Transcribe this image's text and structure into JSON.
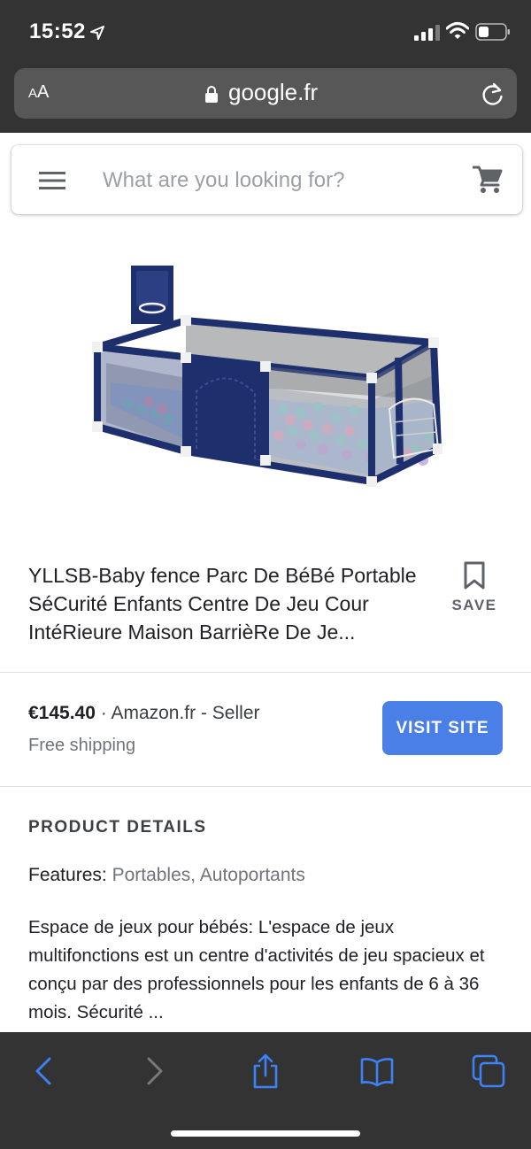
{
  "status_bar": {
    "time": "15:52",
    "icons": [
      "location-arrow-icon",
      "cellular-signal-icon",
      "wifi-icon",
      "battery-icon"
    ]
  },
  "browser": {
    "text_size_label_small": "A",
    "text_size_label_large": "A",
    "url": "google.fr",
    "icons": [
      "lock-icon",
      "reload-icon"
    ]
  },
  "search": {
    "placeholder": "What are you looking for?",
    "icons": [
      "menu-icon",
      "cart-icon"
    ]
  },
  "product": {
    "image_alt": "Blue baby playpen with colored balls and basketball hoop",
    "title": "YLLSB-Baby fence Parc De BéBé Portable SéCurité Enfants Centre De Jeu Cour IntéRieure Maison BarrièRe De Je...",
    "save_label": "SAVE",
    "price": "€145.40",
    "seller_separator": " · ",
    "seller": "Amazon.fr - Seller",
    "shipping": "Free shipping",
    "visit_label": "VISIT SITE"
  },
  "details": {
    "heading": "PRODUCT DETAILS",
    "features_label": "Features:",
    "features_value": "Portables, Autoportants",
    "description": "Espace de jeux pour bébés: L'espace de jeux multifonctions est un centre d'activités de jeu spacieux et conçu par des professionnels pour les enfants de 6 à 36 mois. Sécurité ..."
  },
  "toolbar": {
    "icons": [
      "back-icon",
      "forward-icon",
      "share-icon",
      "bookmarks-icon",
      "tabs-icon"
    ]
  },
  "colors": {
    "chrome": "#333333",
    "url_bar": "#575757",
    "accent": "#4a7fe8",
    "playpen_blue": "#1e2f6e",
    "toolbar_icon_active": "#3b82f6",
    "toolbar_icon_inactive": "#7a7a7a"
  }
}
